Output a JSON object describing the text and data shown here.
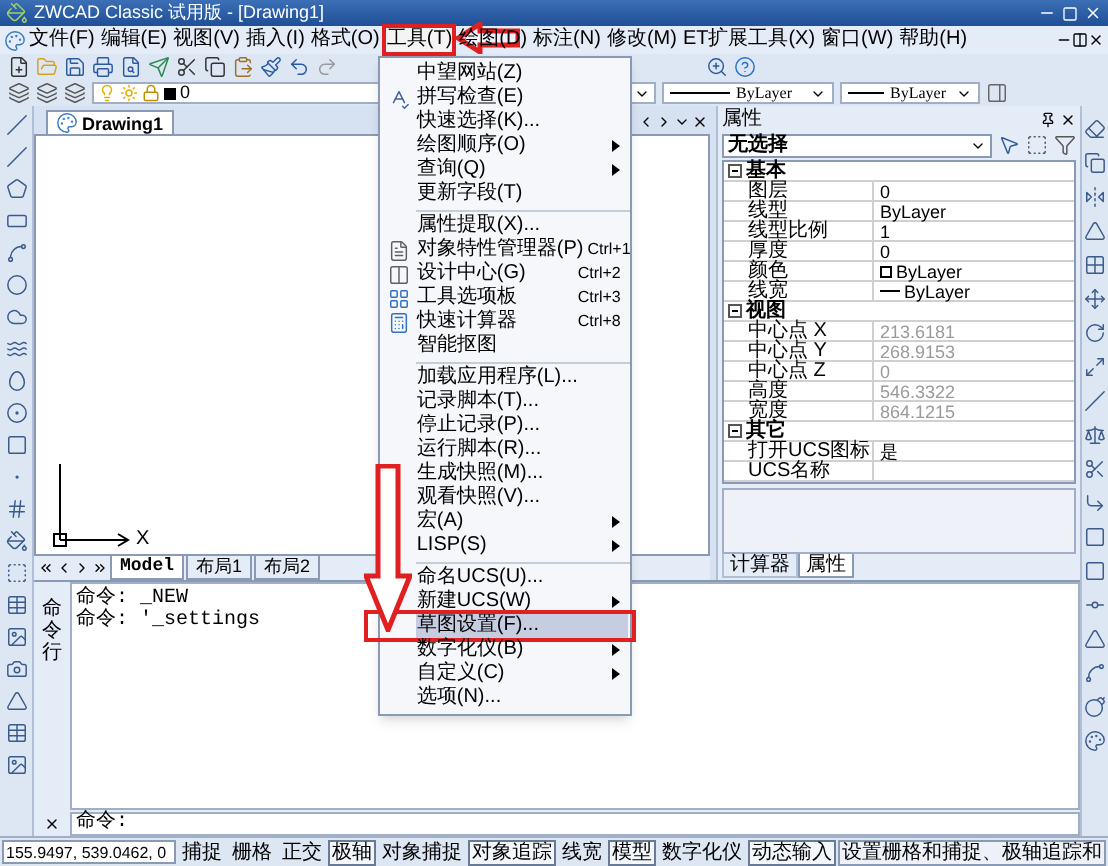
{
  "window": {
    "title": "ZWCAD Classic 试用版 - [Drawing1]"
  },
  "menu_bar": [
    {
      "label": "文件(F)",
      "selected": false
    },
    {
      "label": "编辑(E)",
      "selected": false
    },
    {
      "label": "视图(V)",
      "selected": false
    },
    {
      "label": "插入(I)",
      "selected": false
    },
    {
      "label": "格式(O)",
      "selected": false
    },
    {
      "label": "工具(T)",
      "selected": true
    },
    {
      "label": "绘图(D)",
      "selected": false
    },
    {
      "label": "标注(N)",
      "selected": false
    },
    {
      "label": "修改(M)",
      "selected": false
    },
    {
      "label": "ET扩展工具(X)",
      "selected": false
    },
    {
      "label": "窗口(W)",
      "selected": false
    },
    {
      "label": "帮助(H)",
      "selected": false
    }
  ],
  "layer_toolbar": {
    "layer": "0",
    "linetype": "ByLayer",
    "lineweight": "ByLayer"
  },
  "document_tab": {
    "label": "Drawing1",
    "selected": true
  },
  "ucs_icon": {
    "x_label": "X"
  },
  "layout_tabs": [
    {
      "label": "Model",
      "selected": true
    },
    {
      "label": "布局1",
      "selected": false
    },
    {
      "label": "布局2",
      "selected": false
    }
  ],
  "properties": {
    "title": "属性",
    "selection": "无选择",
    "sections": [
      {
        "title": "基本",
        "expanded": true,
        "rows": [
          {
            "kind": "text",
            "name": "图层",
            "value": "0",
            "disabled": false
          },
          {
            "kind": "text",
            "name": "线型",
            "value": "ByLayer",
            "disabled": false
          },
          {
            "kind": "text",
            "name": "线型比例",
            "value": "1",
            "disabled": false
          },
          {
            "kind": "text",
            "name": "厚度",
            "value": "0",
            "disabled": false
          },
          {
            "kind": "color",
            "name": "颜色",
            "value": "ByLayer",
            "disabled": false
          },
          {
            "kind": "lineweight",
            "name": "线宽",
            "value": "ByLayer",
            "disabled": false
          }
        ]
      },
      {
        "title": "视图",
        "expanded": true,
        "rows": [
          {
            "kind": "text",
            "name": "中心点 X",
            "value": "213.6181",
            "disabled": true
          },
          {
            "kind": "text",
            "name": "中心点 Y",
            "value": "268.9153",
            "disabled": true
          },
          {
            "kind": "text",
            "name": "中心点 Z",
            "value": "0",
            "disabled": true
          },
          {
            "kind": "text",
            "name": "高度",
            "value": "546.3322",
            "disabled": true
          },
          {
            "kind": "text",
            "name": "宽度",
            "value": "864.1215",
            "disabled": true
          }
        ]
      },
      {
        "title": "其它",
        "expanded": true,
        "rows": [
          {
            "kind": "text",
            "name": "打开UCS图标",
            "value": "是",
            "disabled": false
          },
          {
            "kind": "text",
            "name": "UCS名称",
            "disabled": false
          }
        ]
      }
    ],
    "tabs": [
      {
        "label": "计算器",
        "selected": false
      },
      {
        "label": "属性",
        "selected": true
      }
    ]
  },
  "command_line": {
    "label": "命令行",
    "history": [
      "命令: _NEW",
      "命令: '_settings"
    ],
    "prompt": "命令:"
  },
  "status_bar": {
    "coordinates": "155.9497, 539.0462, 0",
    "toggles": [
      {
        "label": "捕捉",
        "on": false
      },
      {
        "label": "栅格",
        "on": false
      },
      {
        "label": "正交",
        "on": false
      },
      {
        "label": "极轴",
        "on": true
      },
      {
        "label": "对象捕捉",
        "on": false
      },
      {
        "label": "对象追踪",
        "on": true
      },
      {
        "label": "线宽",
        "on": false
      },
      {
        "label": "模型",
        "on": true
      },
      {
        "label": "数字化仪",
        "on": false
      },
      {
        "label": "动态输入",
        "on": true
      }
    ],
    "tip": "设置栅格和捕捉、极轴追踪和"
  },
  "tools_menu": [
    {
      "kind": "item",
      "label": "中望网站(Z)",
      "submenu": false,
      "selected": false
    },
    {
      "kind": "item",
      "label": "拼写检查(E)",
      "submenu": false,
      "selected": false
    },
    {
      "kind": "item",
      "label": "快速选择(K)...",
      "submenu": false,
      "selected": false
    },
    {
      "kind": "item",
      "label": "绘图顺序(O)",
      "submenu": true,
      "selected": false
    },
    {
      "kind": "item",
      "label": "查询(Q)",
      "submenu": true,
      "selected": false
    },
    {
      "kind": "item",
      "label": "更新字段(T)",
      "submenu": false,
      "selected": false
    },
    {
      "kind": "separator"
    },
    {
      "kind": "item",
      "label": "属性提取(X)...",
      "submenu": false,
      "selected": false
    },
    {
      "kind": "item",
      "label": "对象特性管理器(P)",
      "shortcut": "Ctrl+1",
      "submenu": false,
      "selected": false
    },
    {
      "kind": "item",
      "label": "设计中心(G)",
      "shortcut": "Ctrl+2",
      "submenu": false,
      "selected": false
    },
    {
      "kind": "item",
      "label": "工具选项板",
      "shortcut": "Ctrl+3",
      "submenu": false,
      "selected": false
    },
    {
      "kind": "item",
      "label": "快速计算器",
      "shortcut": "Ctrl+8",
      "submenu": false,
      "selected": false
    },
    {
      "kind": "item",
      "label": "智能抠图",
      "submenu": false,
      "selected": false
    },
    {
      "kind": "separator"
    },
    {
      "kind": "item",
      "label": "加载应用程序(L)...",
      "submenu": false,
      "selected": false
    },
    {
      "kind": "item",
      "label": "记录脚本(T)...",
      "submenu": false,
      "selected": false
    },
    {
      "kind": "item",
      "label": "停止记录(P)...",
      "submenu": false,
      "selected": false
    },
    {
      "kind": "item",
      "label": "运行脚本(R)...",
      "submenu": false,
      "selected": false
    },
    {
      "kind": "item",
      "label": "生成快照(M)...",
      "submenu": false,
      "selected": false
    },
    {
      "kind": "item",
      "label": "观看快照(V)...",
      "submenu": false,
      "selected": false
    },
    {
      "kind": "item",
      "label": "宏(A)",
      "submenu": true,
      "selected": false
    },
    {
      "kind": "item",
      "label": "LISP(S)",
      "submenu": true,
      "selected": false
    },
    {
      "kind": "separator"
    },
    {
      "kind": "item",
      "label": "命名UCS(U)...",
      "submenu": false,
      "selected": false
    },
    {
      "kind": "item",
      "label": "新建UCS(W)",
      "submenu": true,
      "selected": false
    },
    {
      "kind": "item",
      "label": "草图设置(F)...",
      "submenu": false,
      "selected": true
    },
    {
      "kind": "item",
      "label": "数字化仪(B)",
      "submenu": true,
      "selected": false
    },
    {
      "kind": "item",
      "label": "自定义(C)",
      "submenu": true,
      "selected": false
    },
    {
      "kind": "item",
      "label": "选项(N)...",
      "submenu": false,
      "selected": false
    }
  ]
}
